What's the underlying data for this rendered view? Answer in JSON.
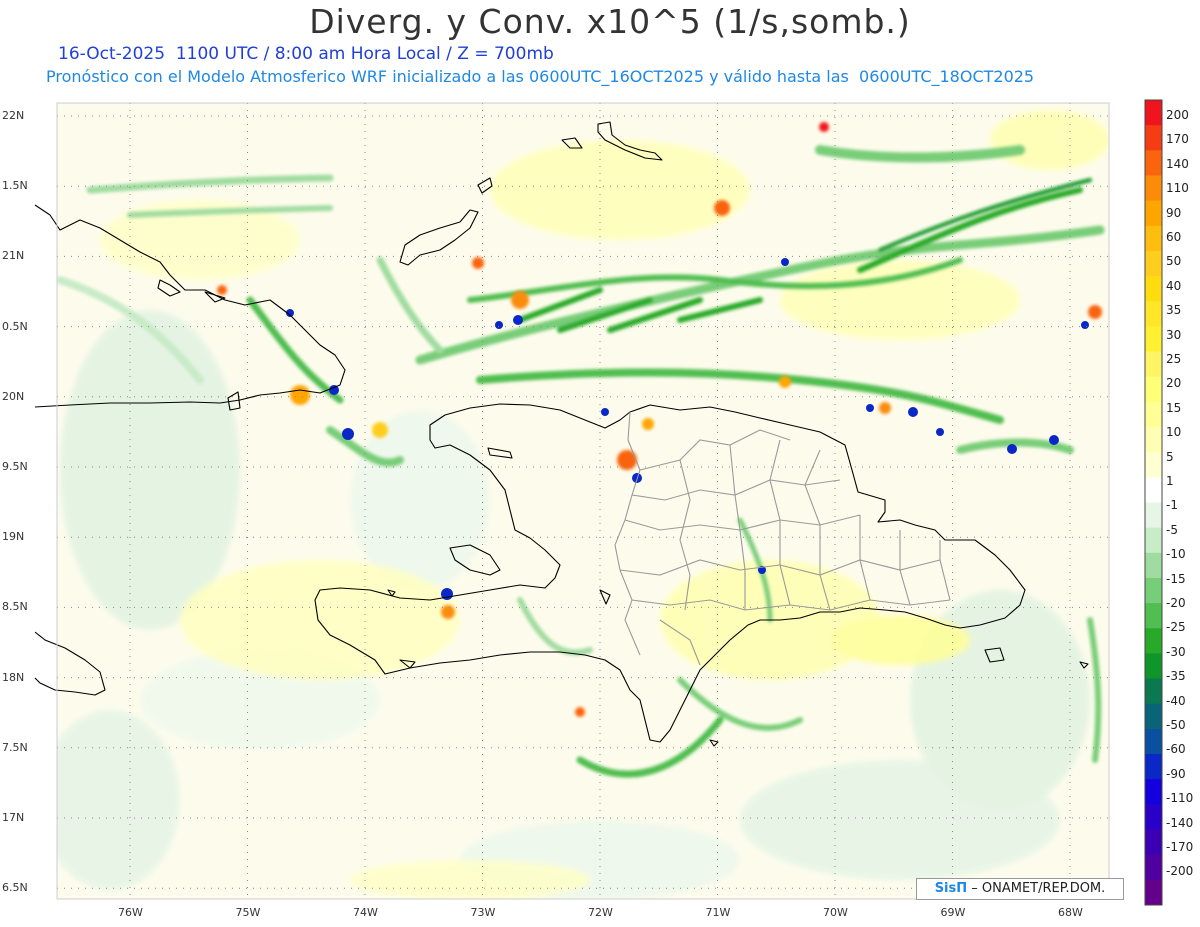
{
  "title": "Diverg. y Conv. x10^5 (1/s,somb.)",
  "subtitle_time": "16-Oct-2025  1100 UTC / 8:00 am Hora Local / Z = 700mb",
  "subtitle_model": "Pronóstico con el Modelo Atmosferico WRF inicializado a las 0600UTC_16OCT2025 y válido hasta las  0600UTC_18OCT2025",
  "credit": {
    "brand": "SisΠ",
    "text": "– ONAMET/REP.DOM."
  },
  "lat_labels": [
    "22N",
    "1.5N",
    "21N",
    "0.5N",
    "20N",
    "9.5N",
    "19N",
    "8.5N",
    "18N",
    "7.5N",
    "17N",
    "6.5N"
  ],
  "lon_labels": [
    "76W",
    "75W",
    "74W",
    "73W",
    "72W",
    "71W",
    "70W",
    "69W",
    "68W"
  ],
  "colorbar": {
    "labels": [
      "200",
      "170",
      "140",
      "110",
      "90",
      "60",
      "50",
      "40",
      "35",
      "30",
      "25",
      "20",
      "15",
      "10",
      "5",
      "1",
      "-1",
      "-5",
      "-10",
      "-15",
      "-20",
      "-25",
      "-30",
      "-35",
      "-40",
      "-50",
      "-60",
      "-90",
      "-110",
      "-140",
      "-170",
      "-200"
    ],
    "colors": [
      "#f0141e",
      "#f53c14",
      "#fa640f",
      "#fa8c0a",
      "#ffa500",
      "#ffbe0f",
      "#ffcd1e",
      "#ffdc0f",
      "#ffe628",
      "#fff032",
      "#fff564",
      "#ffff78",
      "#ffff96",
      "#ffffb4",
      "#ffffd2",
      "#ffffff",
      "#e6f5e6",
      "#c8ebc8",
      "#a0dca0",
      "#78cd78",
      "#50be50",
      "#28aa28",
      "#0f9628",
      "#0a7850",
      "#0a6478",
      "#0a50a0",
      "#0a28c8",
      "#1400dc",
      "#2800c8",
      "#3c00b4",
      "#5000a0",
      "#64008c"
    ]
  },
  "map_colors": {
    "background": "#ffffff",
    "grid": "#888888",
    "coast": "#000000",
    "border": "#9a9a9a",
    "frame": "#ffffff"
  }
}
